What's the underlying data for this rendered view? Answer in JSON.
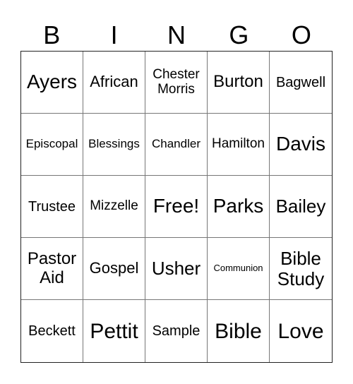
{
  "header": [
    "B",
    "I",
    "N",
    "G",
    "O"
  ],
  "cells": [
    "Ayers",
    "African",
    "Chester Morris",
    "Burton",
    "Bagwell",
    "Episcopal",
    "Blessings",
    "Chandler",
    "Hamilton",
    "Davis",
    "Trustee",
    "Mizzelle",
    "Free!",
    "Parks",
    "Bailey",
    "Pastor Aid",
    "Gospel",
    "Usher",
    "Communion",
    "Bible Study",
    "Beckett",
    "Pettit",
    "Sample",
    "Bible",
    "Love"
  ]
}
